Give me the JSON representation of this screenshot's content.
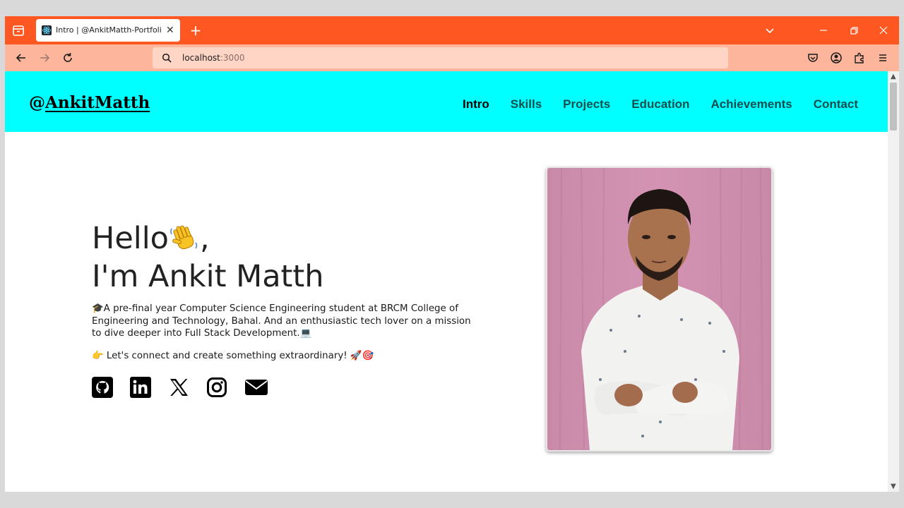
{
  "browser": {
    "tab": {
      "title": "Intro | @AnkitMatth-Portfolio"
    },
    "url": {
      "host": "localhost",
      "port": ":3000"
    },
    "icons": [
      "tab-overview-icon",
      "react-favicon-icon",
      "close-icon",
      "plus-icon",
      "chevron-down-icon",
      "minimize-icon",
      "restore-icon",
      "close-window-icon",
      "back-arrow-icon",
      "forward-arrow-icon",
      "reload-icon",
      "search-icon",
      "pocket-icon",
      "account-icon",
      "extensions-icon",
      "menu-icon"
    ]
  },
  "site": {
    "logo": {
      "at": "@",
      "name": "AnkitMatth"
    },
    "nav": [
      {
        "label": "Intro",
        "active": true
      },
      {
        "label": "Skills"
      },
      {
        "label": "Projects"
      },
      {
        "label": "Education"
      },
      {
        "label": "Achievements"
      },
      {
        "label": "Contact"
      }
    ],
    "colors": {
      "header_bg": "#00ffff",
      "browser_accent": "#fe5722",
      "nav_text": "#134d4d"
    }
  },
  "hero": {
    "hello": "Hello",
    "hello_suffix": ",",
    "name_line": "I'm Ankit Matth",
    "intro": "🎓A pre-final year Computer Science Engineering student at BRCM College of Engineering and Technology, Bahal. And an enthusiastic tech lover on a mission to dive deeper into Full Stack Development.💻",
    "cta": "👉 Let's connect and create something extraordinary! 🚀🎯",
    "socials": [
      "github-icon",
      "linkedin-icon",
      "x-twitter-icon",
      "instagram-icon",
      "email-icon"
    ]
  }
}
